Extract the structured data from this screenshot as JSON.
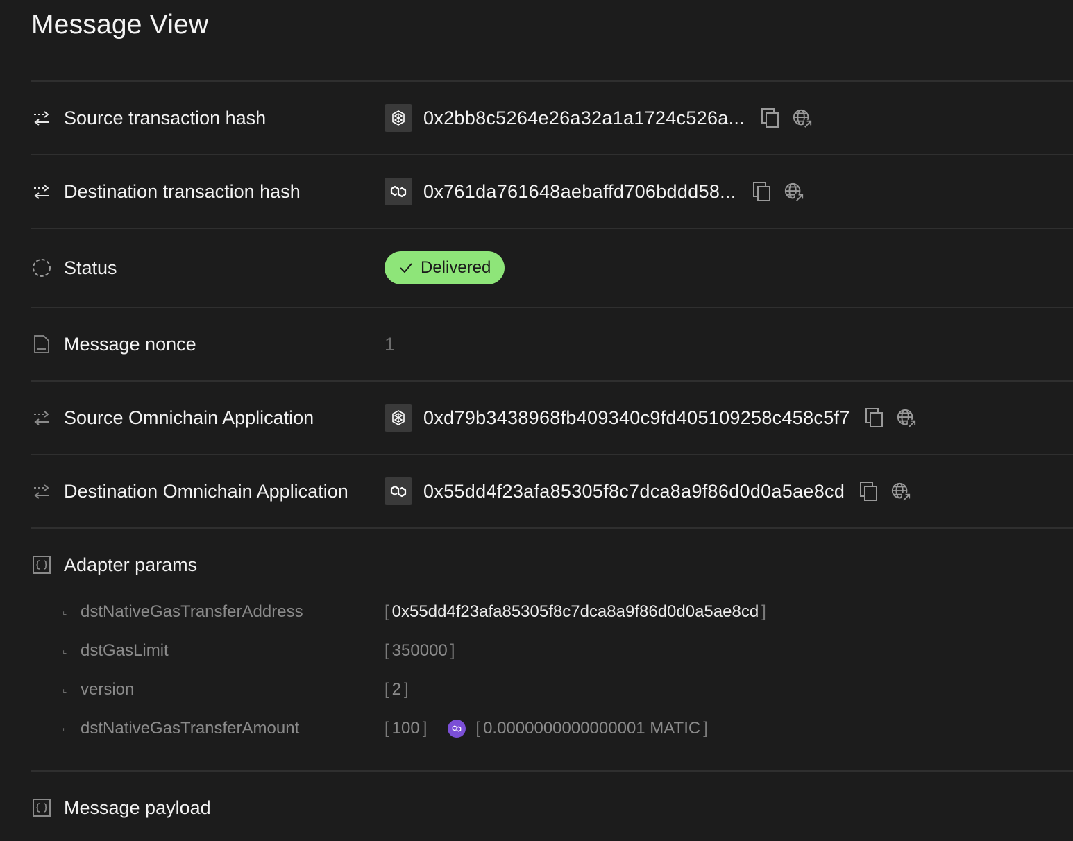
{
  "page": {
    "title": "Message View"
  },
  "rows": {
    "source_tx": {
      "label": "Source transaction hash",
      "chain_icon": "fantom-icon",
      "value": "0x2bb8c5264e26a32a1a1724c526a..."
    },
    "dest_tx": {
      "label": "Destination transaction hash",
      "chain_icon": "polygon-icon",
      "value": "0x761da761648aebaffd706bddd58..."
    },
    "status": {
      "label": "Status",
      "value": "Delivered",
      "color": "#8ee579"
    },
    "nonce": {
      "label": "Message nonce",
      "value": "1"
    },
    "source_oa": {
      "label": "Source Omnichain Application",
      "chain_icon": "fantom-icon",
      "value": "0xd79b3438968fb409340c9fd405109258c458c5f7"
    },
    "dest_oa": {
      "label": "Destination Omnichain Application",
      "chain_icon": "polygon-icon",
      "value": "0x55dd4f23afa85305f8c7dca8a9f86d0d0a5ae8cd"
    },
    "adapter": {
      "label": "Adapter params"
    },
    "payload": {
      "label": "Message payload"
    }
  },
  "adapter_params": [
    {
      "name": "dstNativeGasTransferAddress",
      "value": "0x55dd4f23afa85305f8c7dca8a9f86d0d0a5ae8cd"
    },
    {
      "name": "dstGasLimit",
      "value": "350000"
    },
    {
      "name": "version",
      "value": "2"
    },
    {
      "name": "dstNativeGasTransferAmount",
      "value": "100",
      "converted": "0.0000000000000001 MATIC"
    }
  ],
  "bracket_open": "[",
  "bracket_close": "]",
  "icons": {
    "transfer": "transfer-arrows-icon",
    "status": "spinner-circle-icon",
    "nonce": "document-icon",
    "params": "braces-box-icon",
    "copy": "copy-icon",
    "explorer": "globe-link-icon"
  }
}
